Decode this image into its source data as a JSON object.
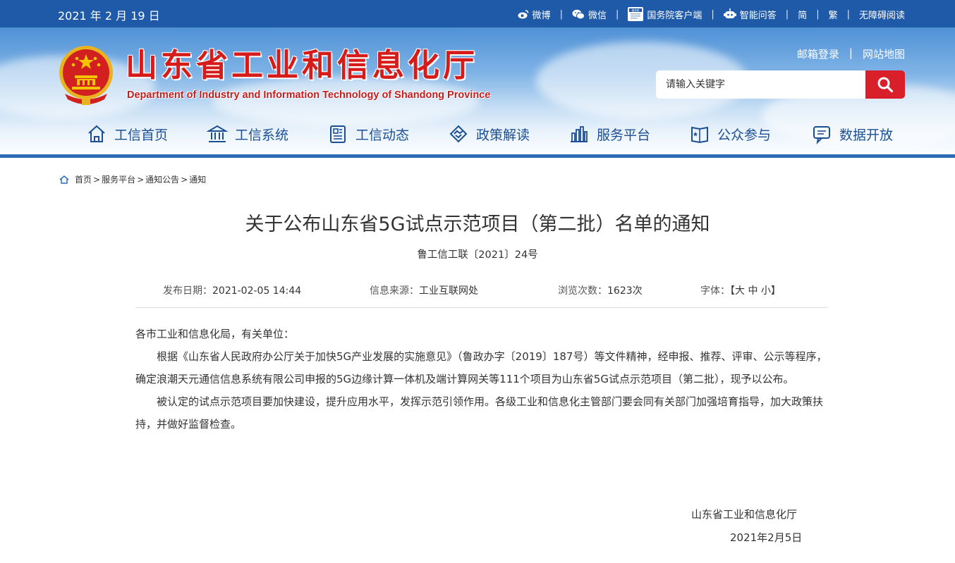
{
  "topbar": {
    "date": "2021 年 2 月 19 日",
    "links": [
      "微博",
      "微信",
      "国务院客户端",
      "智能问答",
      "简",
      "繁",
      "无障碍阅读"
    ],
    "gov_icon_text": "国务院"
  },
  "header": {
    "title": "山东省工业和信息化厅",
    "subtitle": "Department of Industry and Information Technology of Shandong Province",
    "links": [
      "邮箱登录",
      "网站地图"
    ],
    "search_placeholder": "请输入关键字"
  },
  "nav": {
    "items": [
      "工信首页",
      "工信系统",
      "工信动态",
      "政策解读",
      "服务平台",
      "公众参与",
      "数据开放"
    ]
  },
  "breadcrumb": {
    "items": [
      "首页",
      "服务平台",
      "通知公告",
      "通知"
    ],
    "separator": ">"
  },
  "article": {
    "title": "关于公布山东省5G试点示范项目（第二批）名单的通知",
    "doc_number": "鲁工信工联〔2021〕24号",
    "meta": {
      "date_label": "发布日期：",
      "date_value": "2021-02-05 14:44",
      "source_label": "信息来源：",
      "source_value": "工业互联网处",
      "views_label": "浏览次数：",
      "views_value": "1623次",
      "font_label": "字体：",
      "font_open": "【",
      "font_large": "大",
      "font_medium": "中",
      "font_small": "小",
      "font_close": "】"
    },
    "salutation": "各市工业和信息化局，有关单位：",
    "paragraph1": "根据《山东省人民政府办公厅关于加快5G产业发展的实施意见》（鲁政办字〔2019〕187号）等文件精神，经申报、推荐、评审、公示等程序，确定浪潮天元通信信息系统有限公司申报的5G边缘计算一体机及端计算网关等111个项目为山东省5G试点示范项目（第二批），现予以公布。",
    "paragraph2": "被认定的试点示范项目要加快建设，提升应用水平，发挥示范引领作用。各级工业和信息化主管部门要会同有关部门加强培育指导，加大政策扶持，并做好监督检查。",
    "signature_org": "山东省工业和信息化厅",
    "signature_date": "2021年2月5日"
  },
  "colors": {
    "topbar_bg": "#1f5aa8",
    "title_red": "#d61b1b",
    "nav_blue": "#1b4f94",
    "search_button": "#d9202a"
  }
}
